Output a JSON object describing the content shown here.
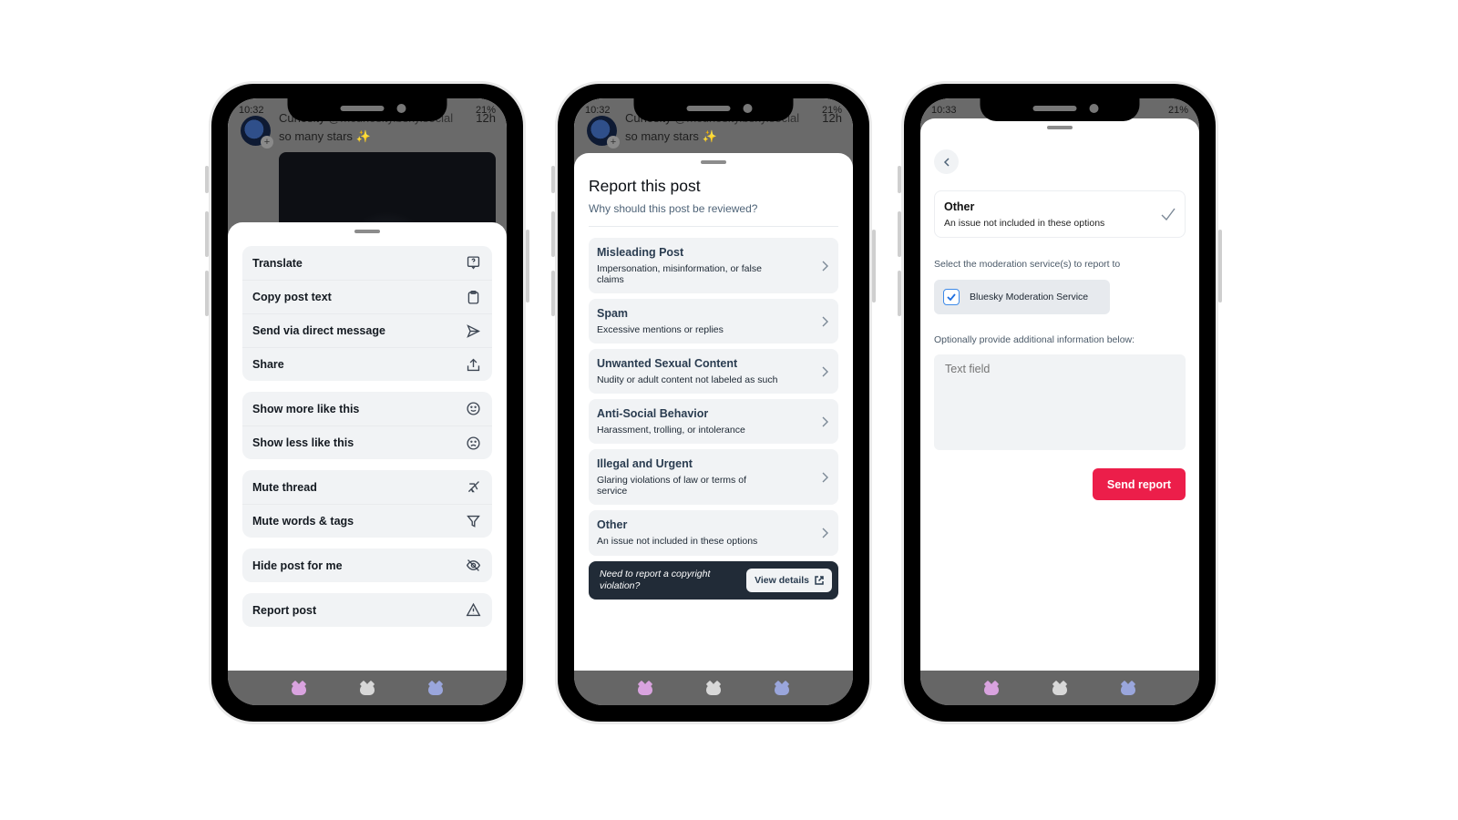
{
  "status_bar": {
    "screen1": {
      "time": "10:32",
      "battery": "21%"
    },
    "screen2": {
      "time": "10:32",
      "battery": "21%"
    },
    "screen3": {
      "time": "10:33",
      "battery": "21%"
    }
  },
  "background_post": {
    "author": "Curiosity",
    "handle": "@mcuriosity.bsky.social",
    "age": "12h",
    "text": "so many stars ✨"
  },
  "post_menu": {
    "groups": [
      [
        {
          "label": "Translate",
          "icon": "translate-icon"
        },
        {
          "label": "Copy post text",
          "icon": "clipboard-icon"
        },
        {
          "label": "Send via direct message",
          "icon": "send-icon"
        },
        {
          "label": "Share",
          "icon": "share-icon"
        }
      ],
      [
        {
          "label": "Show more like this",
          "icon": "smile-icon"
        },
        {
          "label": "Show less like this",
          "icon": "frown-icon"
        }
      ],
      [
        {
          "label": "Mute thread",
          "icon": "mute-thread-icon"
        },
        {
          "label": "Mute words & tags",
          "icon": "filter-icon"
        }
      ],
      [
        {
          "label": "Hide post for me",
          "icon": "eye-slash-icon"
        }
      ],
      [
        {
          "label": "Report post",
          "icon": "warning-icon"
        }
      ]
    ]
  },
  "report": {
    "title": "Report this post",
    "subtitle": "Why should this post be reviewed?",
    "reasons": [
      {
        "title": "Misleading Post",
        "desc": "Impersonation, misinformation, or false claims"
      },
      {
        "title": "Spam",
        "desc": "Excessive mentions or replies"
      },
      {
        "title": "Unwanted Sexual Content",
        "desc": "Nudity or adult content not labeled as such"
      },
      {
        "title": "Anti-Social Behavior",
        "desc": "Harassment, trolling, or intolerance"
      },
      {
        "title": "Illegal and Urgent",
        "desc": "Glaring violations of law or terms of service"
      },
      {
        "title": "Other",
        "desc": "An issue not included in these options"
      }
    ],
    "copyright": {
      "text": "Need to report a copyright violation?",
      "button": "View details"
    }
  },
  "report_details": {
    "selected_reason": {
      "title": "Other",
      "desc": "An issue not included in these options"
    },
    "services_label": "Select the moderation service(s) to report to",
    "service": {
      "name": "Bluesky Moderation Service",
      "checked": true
    },
    "additional_label": "Optionally provide additional information below:",
    "textfield_placeholder": "Text field",
    "send_button": "Send report",
    "accent_color": "#ec1e4a"
  },
  "navbar": {
    "icons": [
      {
        "name": "pink-cat-icon",
        "color": "#d9a3df"
      },
      {
        "name": "white-cat-icon",
        "color": "#d8d8d8"
      },
      {
        "name": "blue-cat-icon",
        "color": "#9aa6dc"
      }
    ]
  }
}
